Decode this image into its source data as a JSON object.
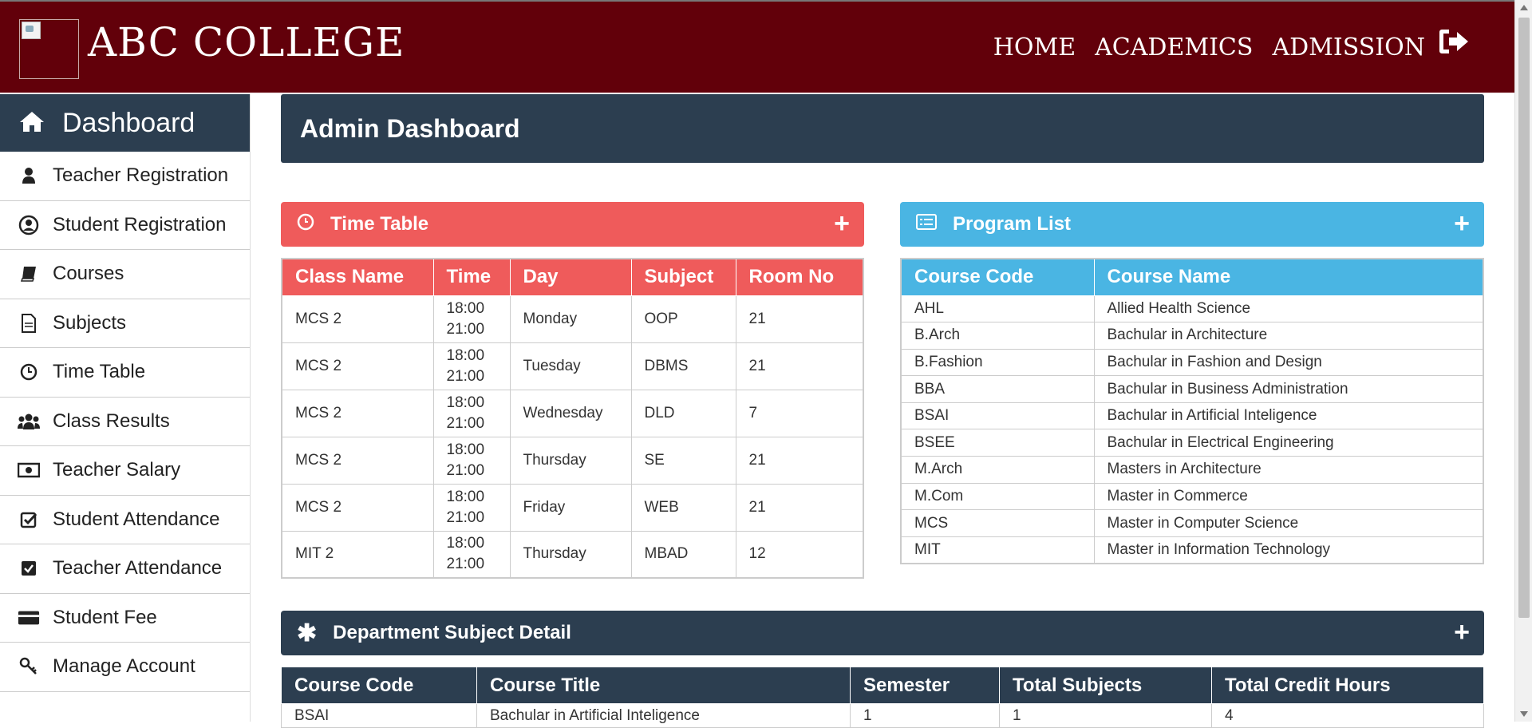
{
  "header": {
    "brand": "ABC COLLEGE",
    "nav": [
      "HOME",
      "ACADEMICS",
      "ADMISSION"
    ]
  },
  "sidebar": {
    "title": "Dashboard",
    "items": [
      {
        "label": "Teacher Registration",
        "icon": "user-icon"
      },
      {
        "label": "Student Registration",
        "icon": "user-circle-icon"
      },
      {
        "label": "Courses",
        "icon": "book-icon"
      },
      {
        "label": "Subjects",
        "icon": "document-icon"
      },
      {
        "label": "Time Table",
        "icon": "clock-icon"
      },
      {
        "label": "Class Results",
        "icon": "users-icon"
      },
      {
        "label": "Teacher Salary",
        "icon": "money-icon"
      },
      {
        "label": "Student Attendance",
        "icon": "check-square-outline-icon"
      },
      {
        "label": "Teacher Attendance",
        "icon": "check-square-icon"
      },
      {
        "label": "Student Fee",
        "icon": "credit-card-icon"
      },
      {
        "label": "Manage Account",
        "icon": "key-icon"
      }
    ]
  },
  "page_title": "Admin Dashboard",
  "timetable": {
    "title": "Time Table",
    "columns": [
      "Class Name",
      "Time",
      "Day",
      "Subject",
      "Room No"
    ],
    "rows": [
      {
        "class": "MCS 2",
        "start": "18:00",
        "end": "21:00",
        "day": "Monday",
        "subject": "OOP",
        "room": "21"
      },
      {
        "class": "MCS 2",
        "start": "18:00",
        "end": "21:00",
        "day": "Tuesday",
        "subject": "DBMS",
        "room": "21"
      },
      {
        "class": "MCS 2",
        "start": "18:00",
        "end": "21:00",
        "day": "Wednesday",
        "subject": "DLD",
        "room": "7"
      },
      {
        "class": "MCS 2",
        "start": "18:00",
        "end": "21:00",
        "day": "Thursday",
        "subject": "SE",
        "room": "21"
      },
      {
        "class": "MCS 2",
        "start": "18:00",
        "end": "21:00",
        "day": "Friday",
        "subject": "WEB",
        "room": "21"
      },
      {
        "class": "MIT 2",
        "start": "18:00",
        "end": "21:00",
        "day": "Thursday",
        "subject": "MBAD",
        "room": "12"
      }
    ]
  },
  "programs": {
    "title": "Program List",
    "columns": [
      "Course Code",
      "Course Name"
    ],
    "rows": [
      {
        "code": "AHL",
        "name": "Allied Health Science"
      },
      {
        "code": "B.Arch",
        "name": "Bachular in Architecture"
      },
      {
        "code": "B.Fashion",
        "name": "Bachular in Fashion and Design"
      },
      {
        "code": "BBA",
        "name": "Bachular in Business Administration"
      },
      {
        "code": "BSAI",
        "name": "Bachular in Artificial Inteligence"
      },
      {
        "code": "BSEE",
        "name": "Bachular in Electrical Engineering"
      },
      {
        "code": "M.Arch",
        "name": "Masters in Architecture"
      },
      {
        "code": "M.Com",
        "name": "Master in Commerce"
      },
      {
        "code": "MCS",
        "name": "Master in Computer Science"
      },
      {
        "code": "MIT",
        "name": "Master in Information Technology"
      }
    ]
  },
  "department": {
    "title": "Department Subject Detail",
    "columns": [
      "Course Code",
      "Course Title",
      "Semester",
      "Total Subjects",
      "Total Credit Hours"
    ],
    "rows": [
      {
        "code": "BSAI",
        "title": "Bachular in Artificial Inteligence",
        "semester": "1",
        "subjects": "1",
        "credits": "4"
      }
    ]
  },
  "colors": {
    "header": "#62000a",
    "navy": "#2c3e50",
    "timetable_accent": "#ef5b5b",
    "program_accent": "#4ab5e3"
  }
}
